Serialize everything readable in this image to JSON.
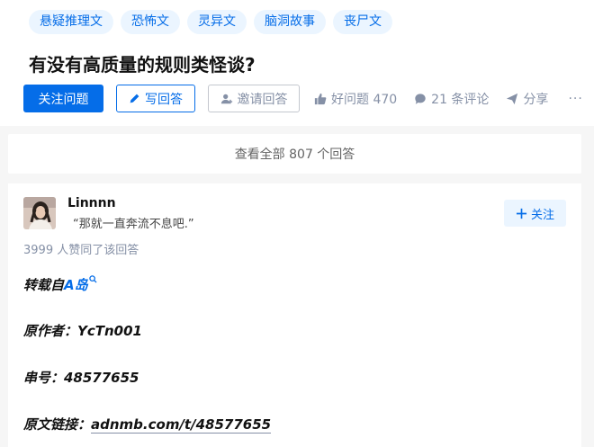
{
  "question": {
    "tags": [
      "悬疑推理文",
      "恐怖文",
      "灵异文",
      "脑洞故事",
      "丧尸文"
    ],
    "title": "有没有高质量的规则类怪谈?",
    "actions": {
      "follow_label": "关注问题",
      "write_label": "写回答",
      "invite_label": "邀请回答",
      "good_question": "好问题 470",
      "comments": "21 条评论",
      "share": "分享",
      "more": "···"
    }
  },
  "view_all": "查看全部 807 个回答",
  "answer": {
    "author": "Linnnn",
    "headline": "“那就一直奔流不息吧.”",
    "follow_label": "关注",
    "voters": "3999 人赞同了该回答",
    "lines": {
      "repost_prefix": "转载自",
      "repost_link": "A岛",
      "author_line": "原作者：YcTn001",
      "serial_line": "串号：48577655",
      "link_label": "原文链接：",
      "link_url": "adnmb.com/t/48577655"
    }
  },
  "colors": {
    "brand": "#056de8",
    "muted": "#8590a6",
    "tag_bg": "#ebf5ff"
  }
}
